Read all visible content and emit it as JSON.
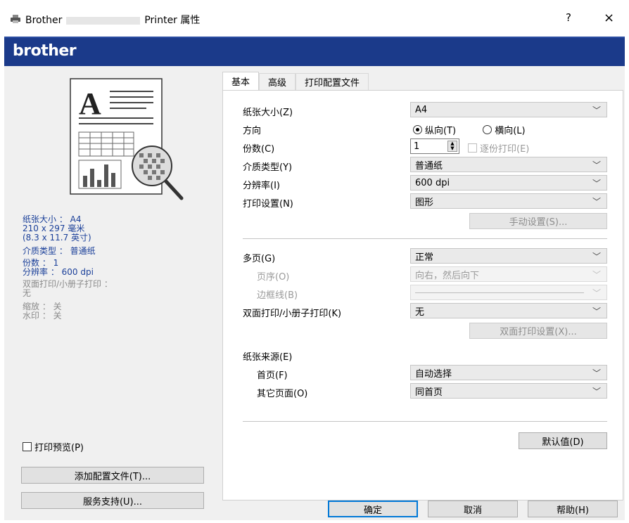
{
  "window": {
    "title_prefix": "Brother",
    "title_suffix": "Printer 属性",
    "help": "?",
    "close": "×"
  },
  "brand": {
    "logo": "brother"
  },
  "summary": {
    "paper_size": "纸张大小 ： A4",
    "dimensions_mm": "210 x 297 毫米",
    "dimensions_in": "(8.3 x 11.7 英寸)",
    "media_type": "介质类型 ： 普通纸",
    "copies": "份数 ： 1",
    "resolution": "分辨率 ： 600 dpi",
    "duplex_label": "双面打印/小册子打印 ：",
    "duplex_value": "无",
    "scaling": "缩放 ： 关",
    "watermark": "水印 ： 关"
  },
  "left_controls": {
    "print_preview": "打印预览(P)",
    "add_profile": "添加配置文件(T)...",
    "support": "服务支持(U)..."
  },
  "tabs": [
    "基本",
    "高级",
    "打印配置文件"
  ],
  "basic": {
    "paper_size_label": "纸张大小(Z)",
    "paper_size_value": "A4",
    "orientation_label": "方向",
    "portrait": "纵向(T)",
    "landscape": "横向(L)",
    "copies_label": "份数(C)",
    "copies_value": "1",
    "collate": "逐份打印(E)",
    "media_label": "介质类型(Y)",
    "media_value": "普通纸",
    "resolution_label": "分辨率(I)",
    "resolution_value": "600 dpi",
    "print_settings_label": "打印设置(N)",
    "print_settings_value": "图形",
    "manual_settings": "手动设置(S)...",
    "multipage_label": "多页(G)",
    "multipage_value": "正常",
    "page_order_label": "页序(O)",
    "page_order_value": "向右，然后向下",
    "border_label": "边框线(B)",
    "duplex_label": "双面打印/小册子打印(K)",
    "duplex_value": "无",
    "duplex_settings": "双面打印设置(X)...",
    "source_label": "纸张来源(E)",
    "first_page_label": "首页(F)",
    "first_page_value": "自动选择",
    "other_pages_label": "其它页面(O)",
    "other_pages_value": "同首页",
    "defaults": "默认值(D)"
  },
  "footer": {
    "ok": "确定",
    "cancel": "取消",
    "help": "帮助(H)"
  }
}
